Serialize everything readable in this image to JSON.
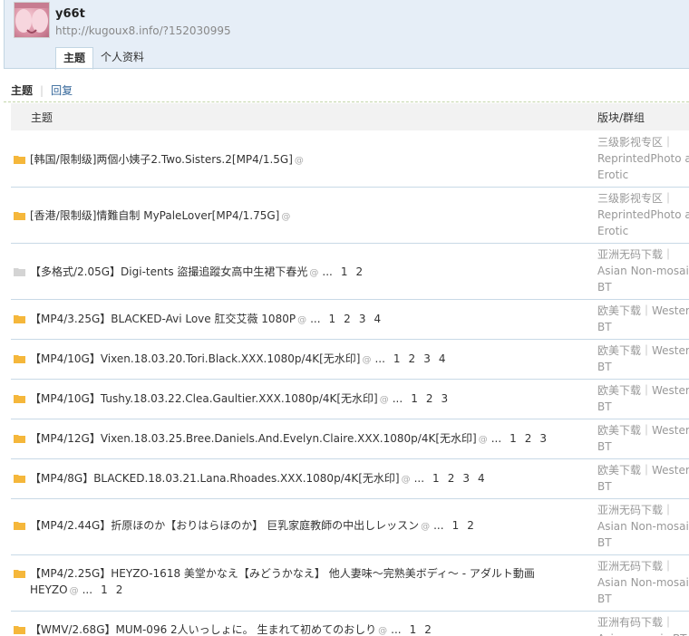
{
  "profile": {
    "username": "y66t",
    "url": "http://kugoux8.info/?152030995"
  },
  "tabs": [
    {
      "label": "主题",
      "active": true
    },
    {
      "label": "个人资料",
      "active": false
    }
  ],
  "subnav": {
    "current": "主题",
    "separator": "|",
    "link": "回复"
  },
  "table": {
    "col_topic": "主题",
    "col_forum": "版块/群组",
    "rows": [
      {
        "folder": "orange",
        "title": "[韩国/限制级]两個小姨子2.Two.Sisters.2[MP4/1.5G]",
        "attach": true,
        "ellipsis": "",
        "pages": [],
        "forum": [
          "三级影视专区｜",
          "ReprintedPhoto and",
          "Erotic"
        ]
      },
      {
        "folder": "orange",
        "title": "[香港/限制级]情難自制 MyPaleLover[MP4/1.75G]",
        "attach": true,
        "ellipsis": "",
        "pages": [],
        "forum": [
          "三级影视专区｜",
          "ReprintedPhoto and",
          "Erotic"
        ]
      },
      {
        "folder": "gray",
        "title": "【多格式/2.05G】Digi-tents 盜撮追蹤女高中生裙下春光",
        "attach": true,
        "ellipsis": "...",
        "pages": [
          "1",
          "2"
        ],
        "forum": [
          "亚洲无码下载｜",
          "Asian Non-mosaic",
          "BT"
        ]
      },
      {
        "folder": "orange",
        "title": "【MP4/3.25G】BLACKED-Avi Love 肛交艾薇 1080P",
        "attach": true,
        "ellipsis": "...",
        "pages": [
          "1",
          "2",
          "3",
          "4"
        ],
        "forum": [
          "欧美下载｜Western",
          "BT"
        ]
      },
      {
        "folder": "orange",
        "title": "【MP4/10G】Vixen.18.03.20.Tori.Black.XXX.1080p/4K[无水印]",
        "attach": true,
        "ellipsis": "...",
        "pages": [
          "1",
          "2",
          "3",
          "4"
        ],
        "forum": [
          "欧美下载｜Western",
          "BT"
        ]
      },
      {
        "folder": "orange",
        "title": "【MP4/10G】Tushy.18.03.22.Clea.Gaultier.XXX.1080p/4K[无水印]",
        "attach": true,
        "ellipsis": "...",
        "pages": [
          "1",
          "2",
          "3"
        ],
        "forum": [
          "欧美下载｜Western",
          "BT"
        ]
      },
      {
        "folder": "orange",
        "title": "【MP4/12G】Vixen.18.03.25.Bree.Daniels.And.Evelyn.Claire.XXX.1080p/4K[无水印]",
        "attach": true,
        "ellipsis": "...",
        "pages": [
          "1",
          "2",
          "3"
        ],
        "forum": [
          "欧美下载｜Western",
          "BT"
        ]
      },
      {
        "folder": "orange",
        "title": "【MP4/8G】BLACKED.18.03.21.Lana.Rhoades.XXX.1080p/4K[无水印]",
        "attach": true,
        "ellipsis": "...",
        "pages": [
          "1",
          "2",
          "3",
          "4"
        ],
        "forum": [
          "欧美下载｜Western",
          "BT"
        ]
      },
      {
        "folder": "orange",
        "title": "【MP4/2.44G】折原ほのか【おりはらほのか】 巨乳家庭教師の中出しレッスン",
        "attach": true,
        "ellipsis": "...",
        "pages": [
          "1",
          "2"
        ],
        "forum": [
          "亚洲无码下载｜",
          "Asian Non-mosaic",
          "BT"
        ]
      },
      {
        "folder": "orange",
        "title": "【MP4/2.25G】HEYZO-1618 美堂かなえ【みどうかなえ】 他人妻味～完熟美ボディ～ - アダルト動画 HEYZO",
        "attach": true,
        "ellipsis": "...",
        "pages": [
          "1",
          "2"
        ],
        "forum": [
          "亚洲无码下载｜",
          "Asian Non-mosaic",
          "BT"
        ]
      },
      {
        "folder": "orange",
        "title": "【WMV/2.68G】MUM-096 2人いっしょに。 生まれて初めてのおしり",
        "attach": true,
        "ellipsis": "...",
        "pages": [
          "1",
          "2"
        ],
        "forum": [
          "亚洲有码下载｜",
          "Asian mosaic BT"
        ]
      }
    ]
  },
  "colors": {
    "header_bg": "#e6eef7",
    "border": "#c2d5e3",
    "link": "#336699",
    "folder": "#f5b73b"
  }
}
